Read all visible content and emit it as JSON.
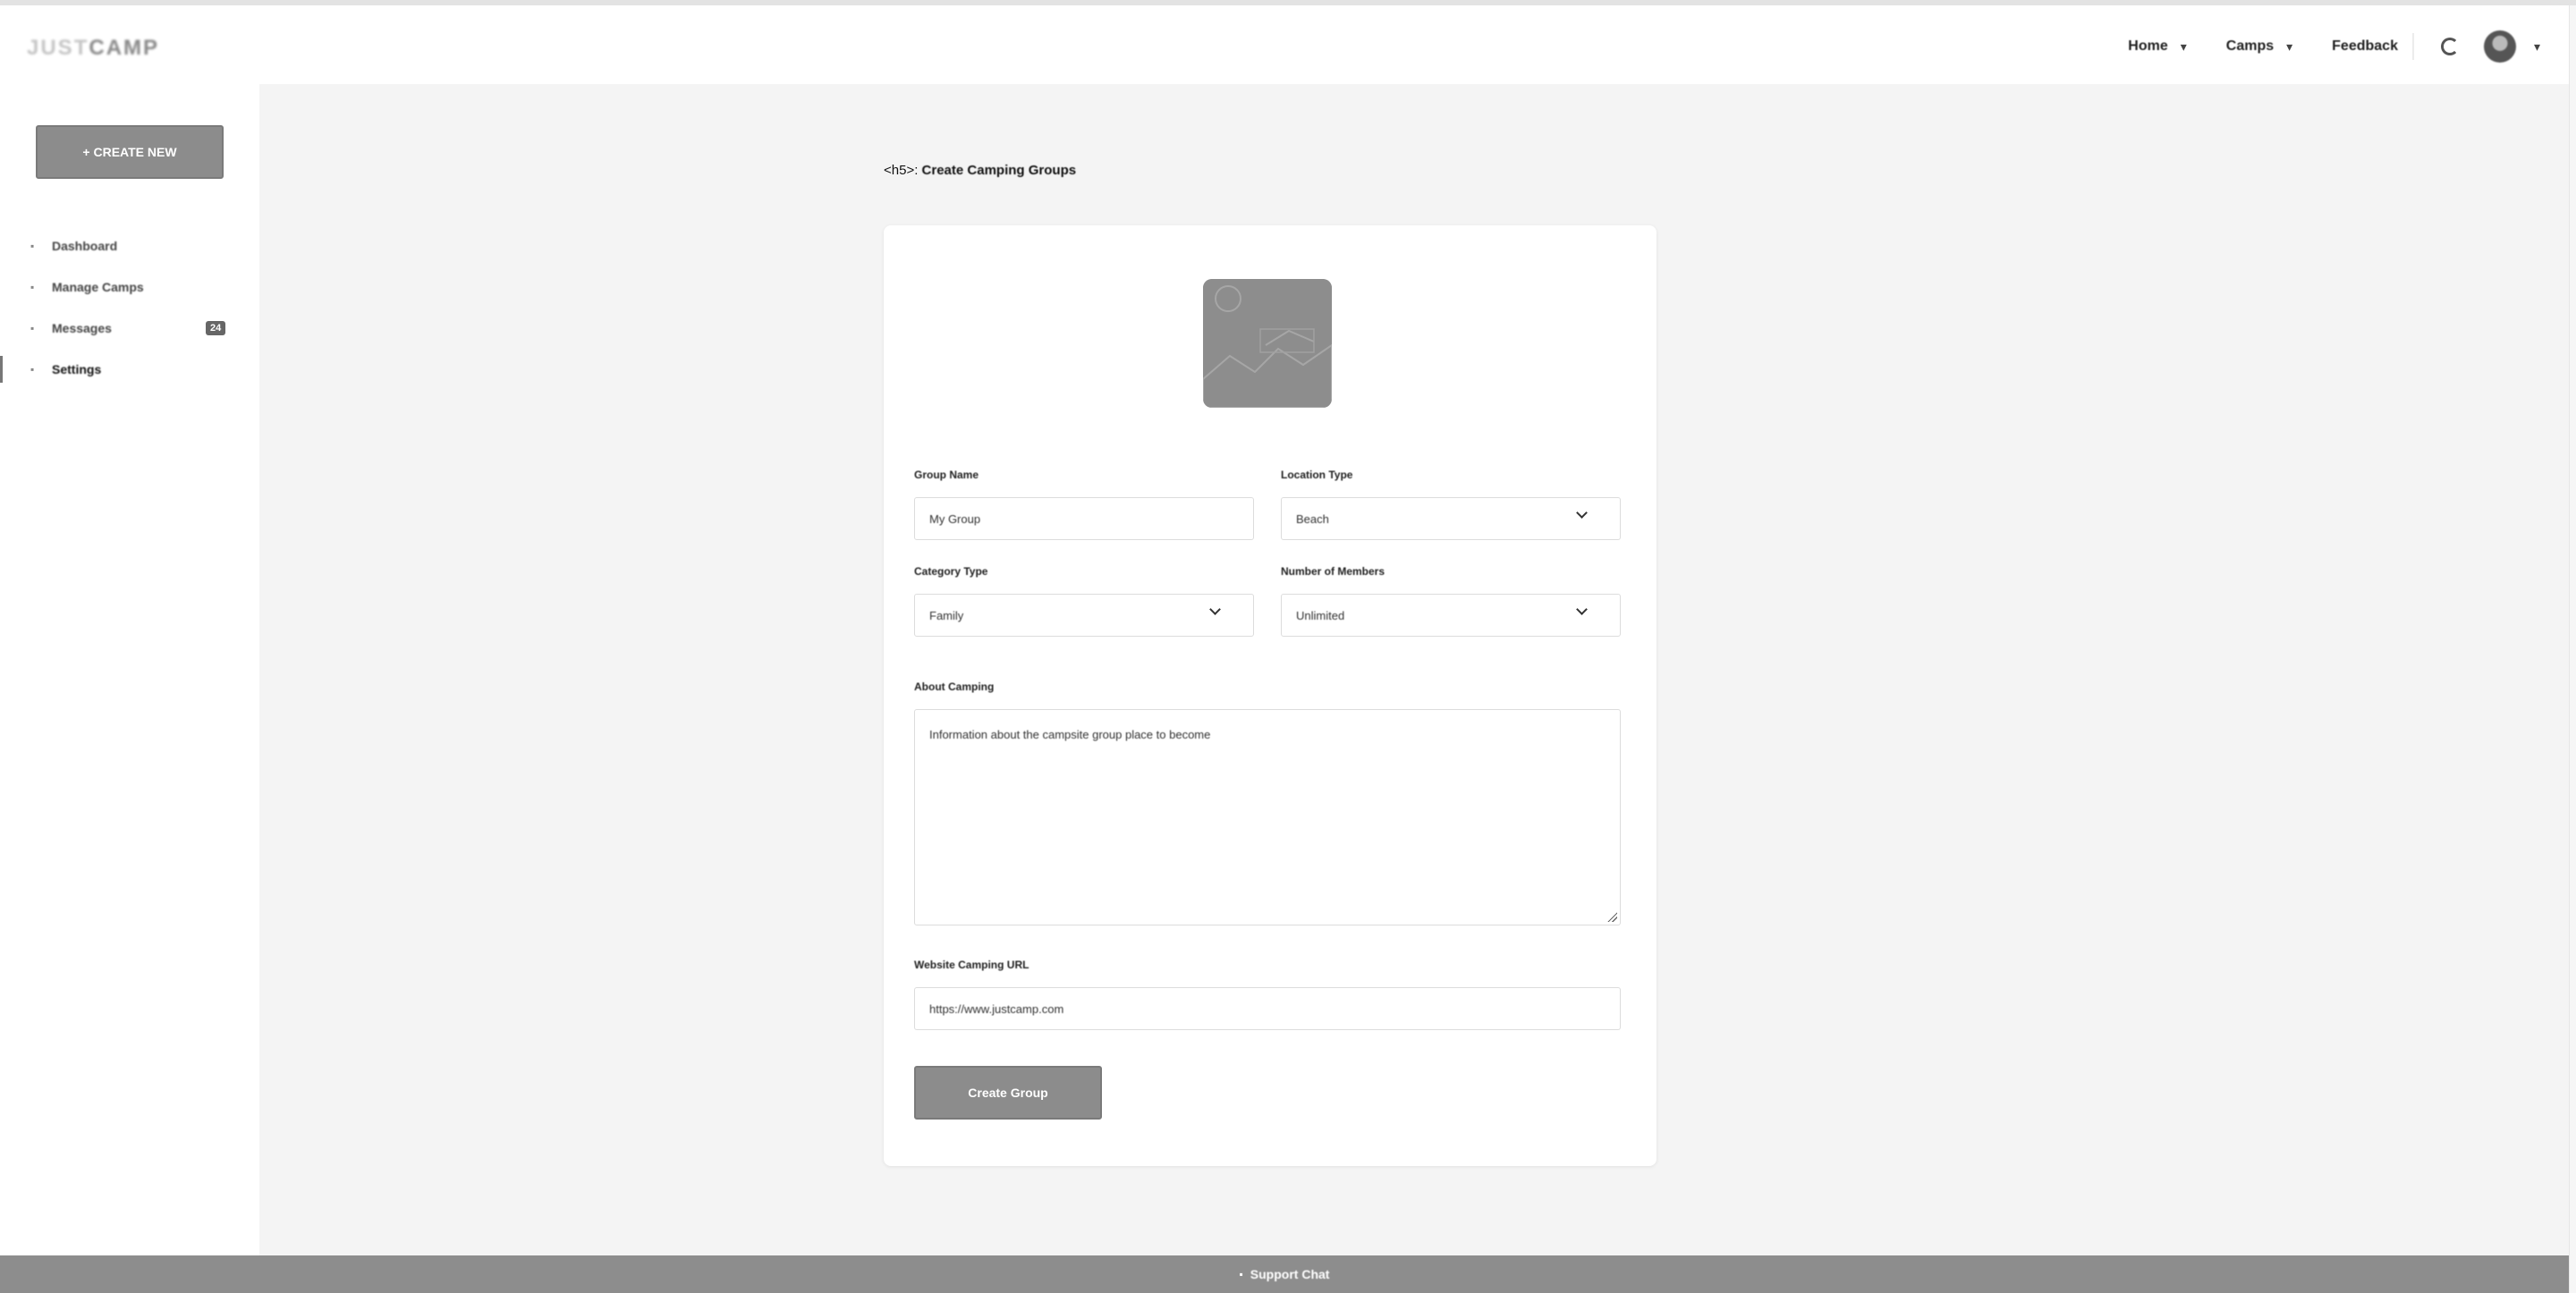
{
  "header": {
    "logo_part1": "JUST",
    "logo_part2": "CAMP",
    "nav": [
      {
        "label": "Home"
      },
      {
        "label": "Camps"
      },
      {
        "label": "Feedback"
      }
    ]
  },
  "sidebar": {
    "new_button": "+ CREATE NEW",
    "items": [
      {
        "label": "Dashboard",
        "icon": "dashboard-icon"
      },
      {
        "label": "Manage Camps",
        "icon": "tent-icon"
      },
      {
        "label": "Messages",
        "icon": "mail-icon",
        "badge": "24"
      },
      {
        "label": "Settings",
        "icon": "gear-icon",
        "active": true
      }
    ]
  },
  "page": {
    "title_prefix": "<h5>:",
    "title": "Create Camping Groups"
  },
  "form": {
    "group_name_label": "Group Name",
    "group_name_value": "My Group",
    "location_label": "Location Type",
    "location_value": "Beach",
    "category_label": "Category Type",
    "category_value": "Family",
    "members_label": "Number of Members",
    "members_value": "Unlimited",
    "about_label": "About Camping",
    "about_value": "Information about the campsite group place to become",
    "link_label": "Website Camping URL",
    "link_value": "https://www.justcamp.com",
    "submit_label": "Create Group"
  },
  "footer": {
    "label": "Support Chat"
  },
  "colors": {
    "button_bg": "#8c8c8c",
    "page_bg": "#f4f4f4",
    "card_bg": "#ffffff"
  }
}
